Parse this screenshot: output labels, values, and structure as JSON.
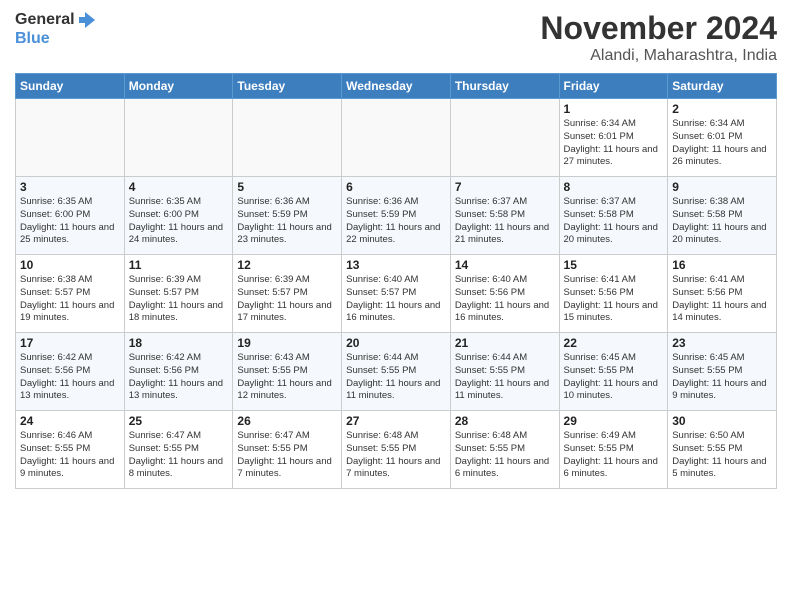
{
  "logo": {
    "general": "General",
    "blue": "Blue"
  },
  "title": "November 2024",
  "location": "Alandi, Maharashtra, India",
  "days_of_week": [
    "Sunday",
    "Monday",
    "Tuesday",
    "Wednesday",
    "Thursday",
    "Friday",
    "Saturday"
  ],
  "weeks": [
    [
      {
        "day": "",
        "info": ""
      },
      {
        "day": "",
        "info": ""
      },
      {
        "day": "",
        "info": ""
      },
      {
        "day": "",
        "info": ""
      },
      {
        "day": "",
        "info": ""
      },
      {
        "day": "1",
        "info": "Sunrise: 6:34 AM\nSunset: 6:01 PM\nDaylight: 11 hours and 27 minutes."
      },
      {
        "day": "2",
        "info": "Sunrise: 6:34 AM\nSunset: 6:01 PM\nDaylight: 11 hours and 26 minutes."
      }
    ],
    [
      {
        "day": "3",
        "info": "Sunrise: 6:35 AM\nSunset: 6:00 PM\nDaylight: 11 hours and 25 minutes."
      },
      {
        "day": "4",
        "info": "Sunrise: 6:35 AM\nSunset: 6:00 PM\nDaylight: 11 hours and 24 minutes."
      },
      {
        "day": "5",
        "info": "Sunrise: 6:36 AM\nSunset: 5:59 PM\nDaylight: 11 hours and 23 minutes."
      },
      {
        "day": "6",
        "info": "Sunrise: 6:36 AM\nSunset: 5:59 PM\nDaylight: 11 hours and 22 minutes."
      },
      {
        "day": "7",
        "info": "Sunrise: 6:37 AM\nSunset: 5:58 PM\nDaylight: 11 hours and 21 minutes."
      },
      {
        "day": "8",
        "info": "Sunrise: 6:37 AM\nSunset: 5:58 PM\nDaylight: 11 hours and 20 minutes."
      },
      {
        "day": "9",
        "info": "Sunrise: 6:38 AM\nSunset: 5:58 PM\nDaylight: 11 hours and 20 minutes."
      }
    ],
    [
      {
        "day": "10",
        "info": "Sunrise: 6:38 AM\nSunset: 5:57 PM\nDaylight: 11 hours and 19 minutes."
      },
      {
        "day": "11",
        "info": "Sunrise: 6:39 AM\nSunset: 5:57 PM\nDaylight: 11 hours and 18 minutes."
      },
      {
        "day": "12",
        "info": "Sunrise: 6:39 AM\nSunset: 5:57 PM\nDaylight: 11 hours and 17 minutes."
      },
      {
        "day": "13",
        "info": "Sunrise: 6:40 AM\nSunset: 5:57 PM\nDaylight: 11 hours and 16 minutes."
      },
      {
        "day": "14",
        "info": "Sunrise: 6:40 AM\nSunset: 5:56 PM\nDaylight: 11 hours and 16 minutes."
      },
      {
        "day": "15",
        "info": "Sunrise: 6:41 AM\nSunset: 5:56 PM\nDaylight: 11 hours and 15 minutes."
      },
      {
        "day": "16",
        "info": "Sunrise: 6:41 AM\nSunset: 5:56 PM\nDaylight: 11 hours and 14 minutes."
      }
    ],
    [
      {
        "day": "17",
        "info": "Sunrise: 6:42 AM\nSunset: 5:56 PM\nDaylight: 11 hours and 13 minutes."
      },
      {
        "day": "18",
        "info": "Sunrise: 6:42 AM\nSunset: 5:56 PM\nDaylight: 11 hours and 13 minutes."
      },
      {
        "day": "19",
        "info": "Sunrise: 6:43 AM\nSunset: 5:55 PM\nDaylight: 11 hours and 12 minutes."
      },
      {
        "day": "20",
        "info": "Sunrise: 6:44 AM\nSunset: 5:55 PM\nDaylight: 11 hours and 11 minutes."
      },
      {
        "day": "21",
        "info": "Sunrise: 6:44 AM\nSunset: 5:55 PM\nDaylight: 11 hours and 11 minutes."
      },
      {
        "day": "22",
        "info": "Sunrise: 6:45 AM\nSunset: 5:55 PM\nDaylight: 11 hours and 10 minutes."
      },
      {
        "day": "23",
        "info": "Sunrise: 6:45 AM\nSunset: 5:55 PM\nDaylight: 11 hours and 9 minutes."
      }
    ],
    [
      {
        "day": "24",
        "info": "Sunrise: 6:46 AM\nSunset: 5:55 PM\nDaylight: 11 hours and 9 minutes."
      },
      {
        "day": "25",
        "info": "Sunrise: 6:47 AM\nSunset: 5:55 PM\nDaylight: 11 hours and 8 minutes."
      },
      {
        "day": "26",
        "info": "Sunrise: 6:47 AM\nSunset: 5:55 PM\nDaylight: 11 hours and 7 minutes."
      },
      {
        "day": "27",
        "info": "Sunrise: 6:48 AM\nSunset: 5:55 PM\nDaylight: 11 hours and 7 minutes."
      },
      {
        "day": "28",
        "info": "Sunrise: 6:48 AM\nSunset: 5:55 PM\nDaylight: 11 hours and 6 minutes."
      },
      {
        "day": "29",
        "info": "Sunrise: 6:49 AM\nSunset: 5:55 PM\nDaylight: 11 hours and 6 minutes."
      },
      {
        "day": "30",
        "info": "Sunrise: 6:50 AM\nSunset: 5:55 PM\nDaylight: 11 hours and 5 minutes."
      }
    ]
  ]
}
